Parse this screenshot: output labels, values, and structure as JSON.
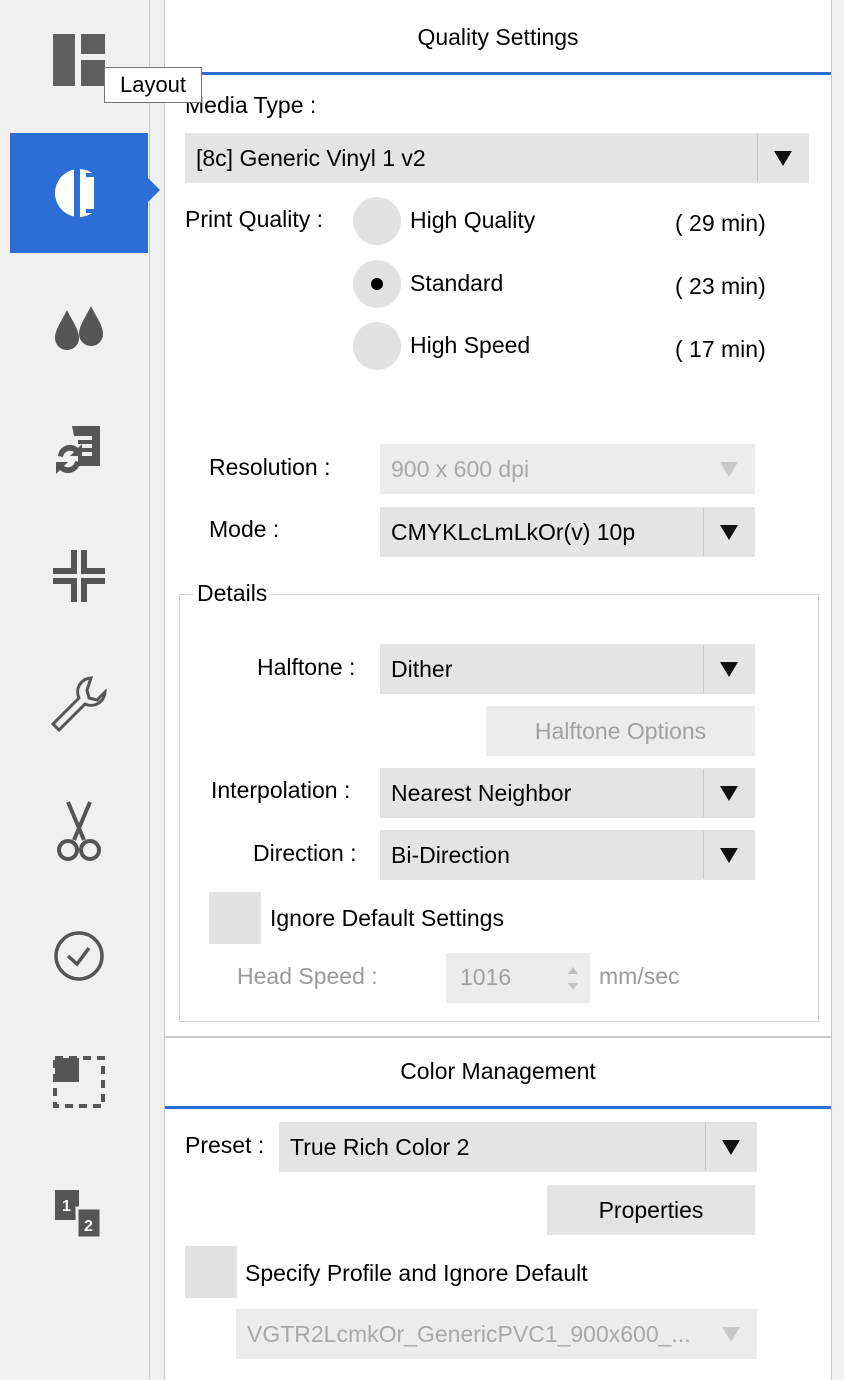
{
  "tooltip": "Layout",
  "sidebar": {
    "items": [
      {
        "icon": "layout-icon",
        "active": false
      },
      {
        "icon": "quality-settings-icon",
        "active": true
      },
      {
        "icon": "ink-drops-icon",
        "active": false
      },
      {
        "icon": "document-refresh-icon",
        "active": false
      },
      {
        "icon": "crop-marks-icon",
        "active": false
      },
      {
        "icon": "wrench-icon",
        "active": false
      },
      {
        "icon": "scissors-icon",
        "active": false
      },
      {
        "icon": "clock-icon",
        "active": false
      },
      {
        "icon": "selection-icon",
        "active": false
      },
      {
        "icon": "page-order-icon",
        "active": false
      }
    ],
    "accent": "#2b6fd6"
  },
  "quality": {
    "title": "Quality Settings",
    "media_type_label": "Media Type :",
    "media_type_value": "[8c] Generic Vinyl 1 v2",
    "print_quality_label": "Print Quality :",
    "options": [
      {
        "label": "High Quality",
        "time": "( 29 min)",
        "selected": false
      },
      {
        "label": "Standard",
        "time": "( 23 min)",
        "selected": true
      },
      {
        "label": "High Speed",
        "time": "( 17 min)",
        "selected": false
      }
    ],
    "resolution_label": "Resolution :",
    "resolution_value": "900 x 600 dpi",
    "mode_label": "Mode :",
    "mode_value": "CMYKLcLmLkOr(v) 10p",
    "details": {
      "legend": "Details",
      "halftone_label": "Halftone :",
      "halftone_value": "Dither",
      "halftone_options_button": "Halftone Options",
      "interpolation_label": "Interpolation :",
      "interpolation_value": "Nearest Neighbor",
      "direction_label": "Direction :",
      "direction_value": "Bi-Direction",
      "ignore_default_label": "Ignore Default Settings",
      "head_speed_label": "Head Speed :",
      "head_speed_value": "1016",
      "head_speed_unit": "mm/sec"
    }
  },
  "color": {
    "title": "Color Management",
    "preset_label": "Preset :",
    "preset_value": "True Rich Color 2",
    "properties_button": "Properties",
    "specify_profile_label": "Specify Profile and Ignore Default",
    "profile_value": "VGTR2LcmkOr_GenericPVC1_900x600_..."
  }
}
